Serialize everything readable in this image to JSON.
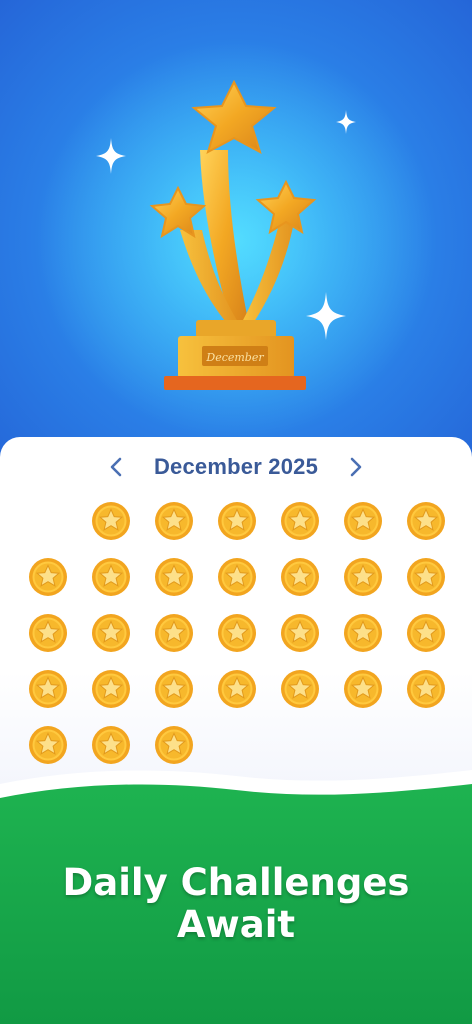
{
  "hero": {
    "trophy_plaque": "December",
    "colors": {
      "sky": "#2f7fe6",
      "glow": "#3fd7ff",
      "gold": "#f6b52a"
    }
  },
  "calendar": {
    "month_label": "December 2025",
    "prev_icon": "chevron-left-icon",
    "next_icon": "chevron-right-icon",
    "leading_blanks": 1,
    "days_with_coins": 30,
    "coin_icon": "star-coin-icon",
    "colors": {
      "title": "#3a5a98",
      "coin": "#f5b229"
    }
  },
  "footer": {
    "tagline_line1": "Daily Challenges",
    "tagline_line2": "Await",
    "colors": {
      "green": "#17a64b"
    }
  }
}
